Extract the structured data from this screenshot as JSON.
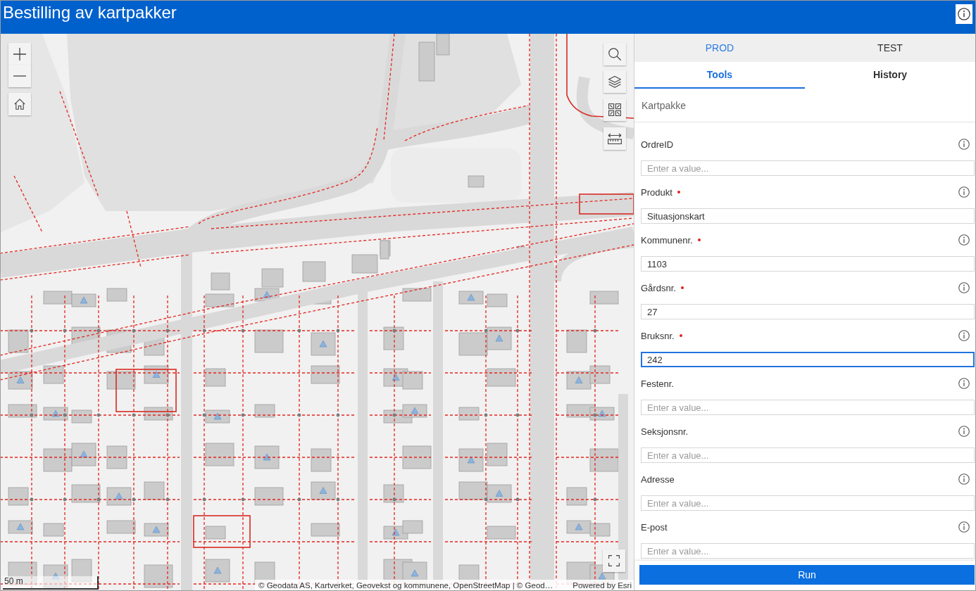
{
  "header": {
    "title": "Bestilling av kartpakker"
  },
  "map": {
    "scale": "50 m",
    "attribution": "© Geodata AS, Kartverket, Geovekst og kommunene, OpenStreetMap | © Geod…",
    "powered_by": "Powered by Esri"
  },
  "panel": {
    "environment_tabs": [
      {
        "label": "PROD",
        "selected": true
      },
      {
        "label": "TEST",
        "selected": false
      }
    ],
    "tabs": [
      {
        "label": "Tools",
        "selected": true
      },
      {
        "label": "History",
        "selected": false
      }
    ],
    "section_title": "Kartpakke",
    "fields": [
      {
        "label": "OrdreID",
        "required": false,
        "placeholder": "Enter a value...",
        "focused": false
      },
      {
        "label": "Produkt",
        "required": true,
        "value": "Situasjonskart",
        "focused": false
      },
      {
        "label": "Kommunenr.",
        "required": true,
        "value": "1103",
        "focused": false
      },
      {
        "label": "Gårdsnr.",
        "required": true,
        "value": "27",
        "focused": false
      },
      {
        "label": "Bruksnr.",
        "required": true,
        "value": "242",
        "focused": true
      },
      {
        "label": "Festenr.",
        "required": false,
        "placeholder": "Enter a value...",
        "focused": false
      },
      {
        "label": "Seksjonsnr.",
        "required": false,
        "placeholder": "Enter a value...",
        "focused": false
      },
      {
        "label": "Adresse",
        "required": false,
        "placeholder": "Enter a value...",
        "focused": false
      },
      {
        "label": "E-post",
        "required": false,
        "placeholder": "Enter a value...",
        "focused": false
      }
    ],
    "run_button": "Run"
  }
}
